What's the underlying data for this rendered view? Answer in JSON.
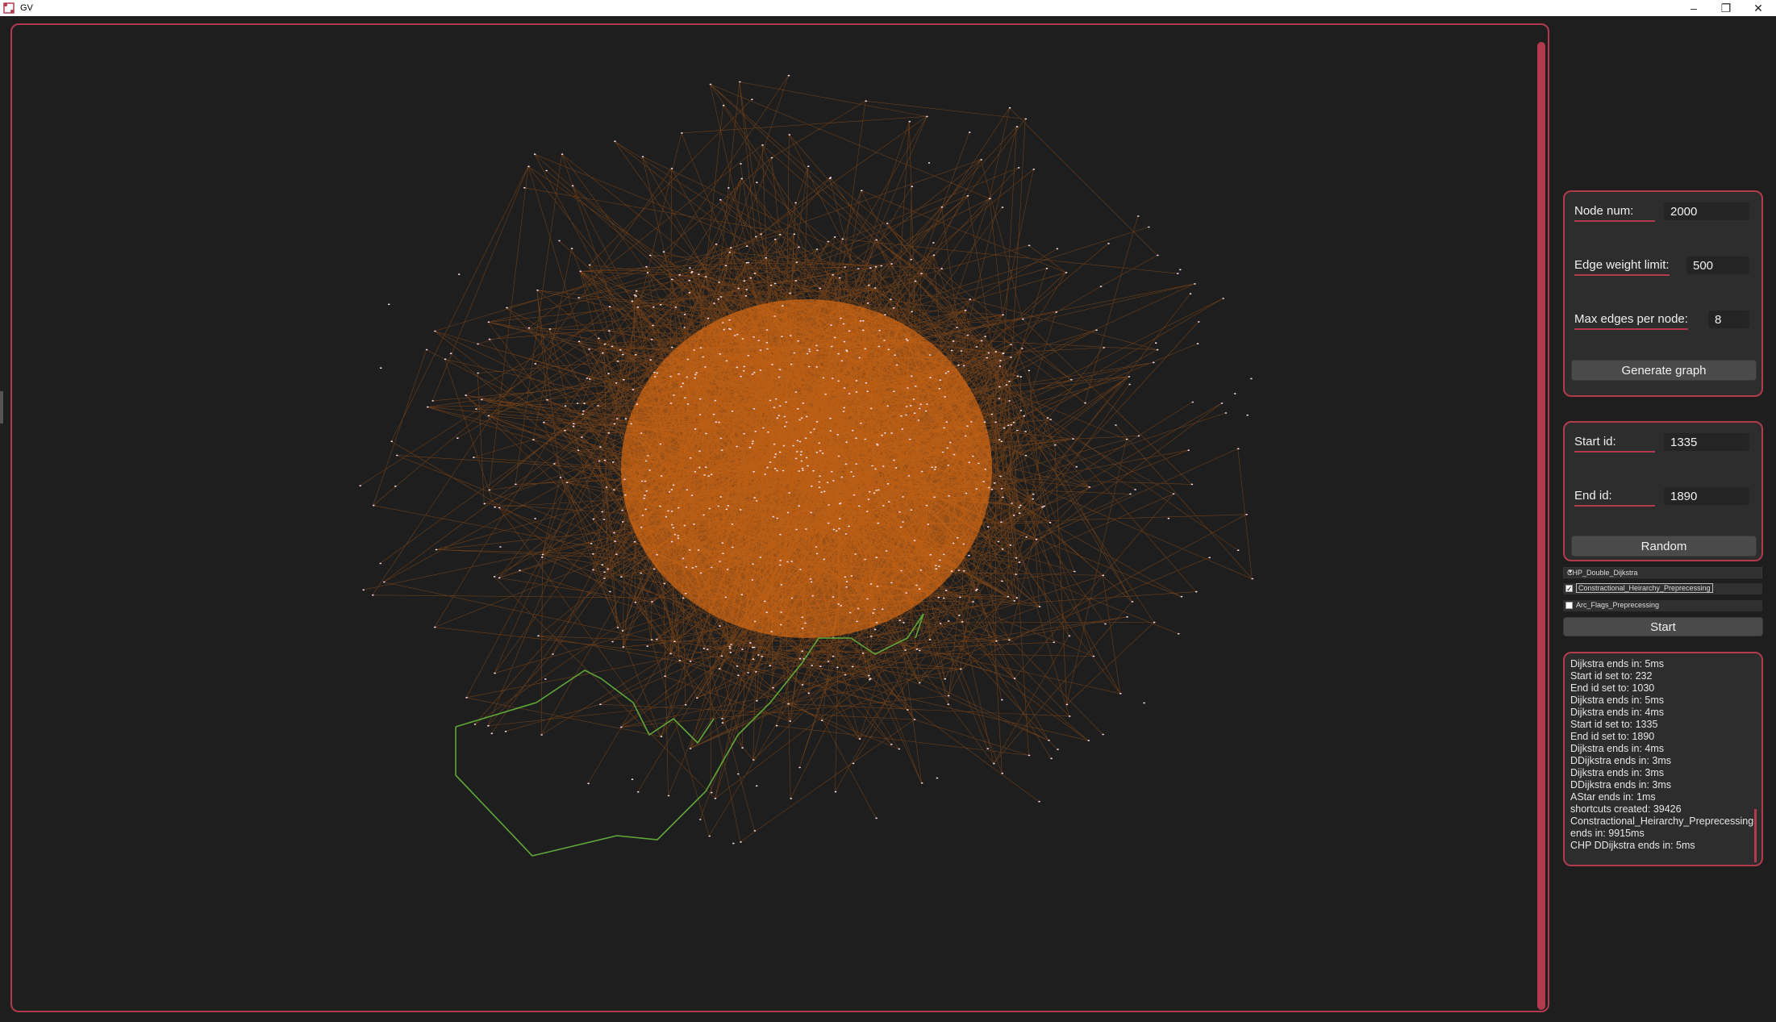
{
  "window": {
    "title": "GV",
    "controls": [
      "minimize-icon",
      "restore-icon",
      "close-icon"
    ]
  },
  "colors": {
    "accent": "#b23a4e",
    "edge": "#ff7a12",
    "path": "#5fa838",
    "node": "#f4d8e4",
    "background": "#1e1e1e"
  },
  "generator": {
    "node_num": {
      "label": "Node num:",
      "value": "2000"
    },
    "edge_weight_limit": {
      "label": "Edge weight limit:",
      "value": "500"
    },
    "max_edges_per_node": {
      "label": "Max edges per node:",
      "value": "8"
    },
    "generate_label": "Generate graph"
  },
  "route": {
    "start_id": {
      "label": "Start id:",
      "value": "1335"
    },
    "end_id": {
      "label": "End id:",
      "value": "1890"
    },
    "random_label": "Random"
  },
  "algorithm": {
    "selected": "CHP_Double_Dijkstra",
    "options_visible": [
      "CHP_Double_Dijkstra"
    ]
  },
  "preprocessing": [
    {
      "label": "Constractional_Heirarchy_Preprecessing",
      "checked": true
    },
    {
      "label": "Arc_Flags_Preprecessing",
      "checked": false
    }
  ],
  "start_label": "Start",
  "log": [
    "Dijkstra ends in: 5ms",
    "Start id set to: 232",
    "End id set to: 1030",
    "Dijkstra ends in: 5ms",
    "Dijkstra ends in: 4ms",
    "Start id set to: 1335",
    "End id set to: 1890",
    "Dijkstra ends in: 4ms",
    "DDijkstra ends in: 3ms",
    "Dijkstra ends in: 3ms",
    "DDijkstra ends in: 3ms",
    "AStar ends in: 1ms",
    "shortcuts created: 39426",
    "Constractional_Heirarchy_Preprecessing",
    "ends in: 9915ms",
    "CHP DDijkstra ends in: 5ms"
  ]
}
